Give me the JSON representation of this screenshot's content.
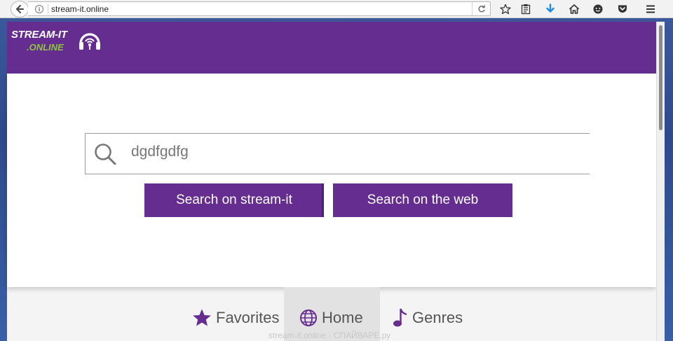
{
  "browser": {
    "url": "stream-it.online",
    "icons": [
      "back-icon",
      "info-icon",
      "reload-icon",
      "bookmark-star-icon",
      "reading-list-icon",
      "download-icon",
      "home-icon",
      "chat-icon",
      "pocket-icon",
      "menu-icon"
    ]
  },
  "site": {
    "logo_line1": "STREAM-IT",
    "logo_line2": ".ONLINE",
    "brand_color": "#662d91",
    "accent_color": "#8dc63f"
  },
  "search": {
    "value": "dgdfgdfg",
    "button_site": "Search on stream-it",
    "button_web": "Search on the web"
  },
  "nav": {
    "favorites": "Favorites",
    "home": "Home",
    "genres": "Genres",
    "active": "Home"
  },
  "watermark": "stream-it.online - СПАЙВАРЕ.ру"
}
